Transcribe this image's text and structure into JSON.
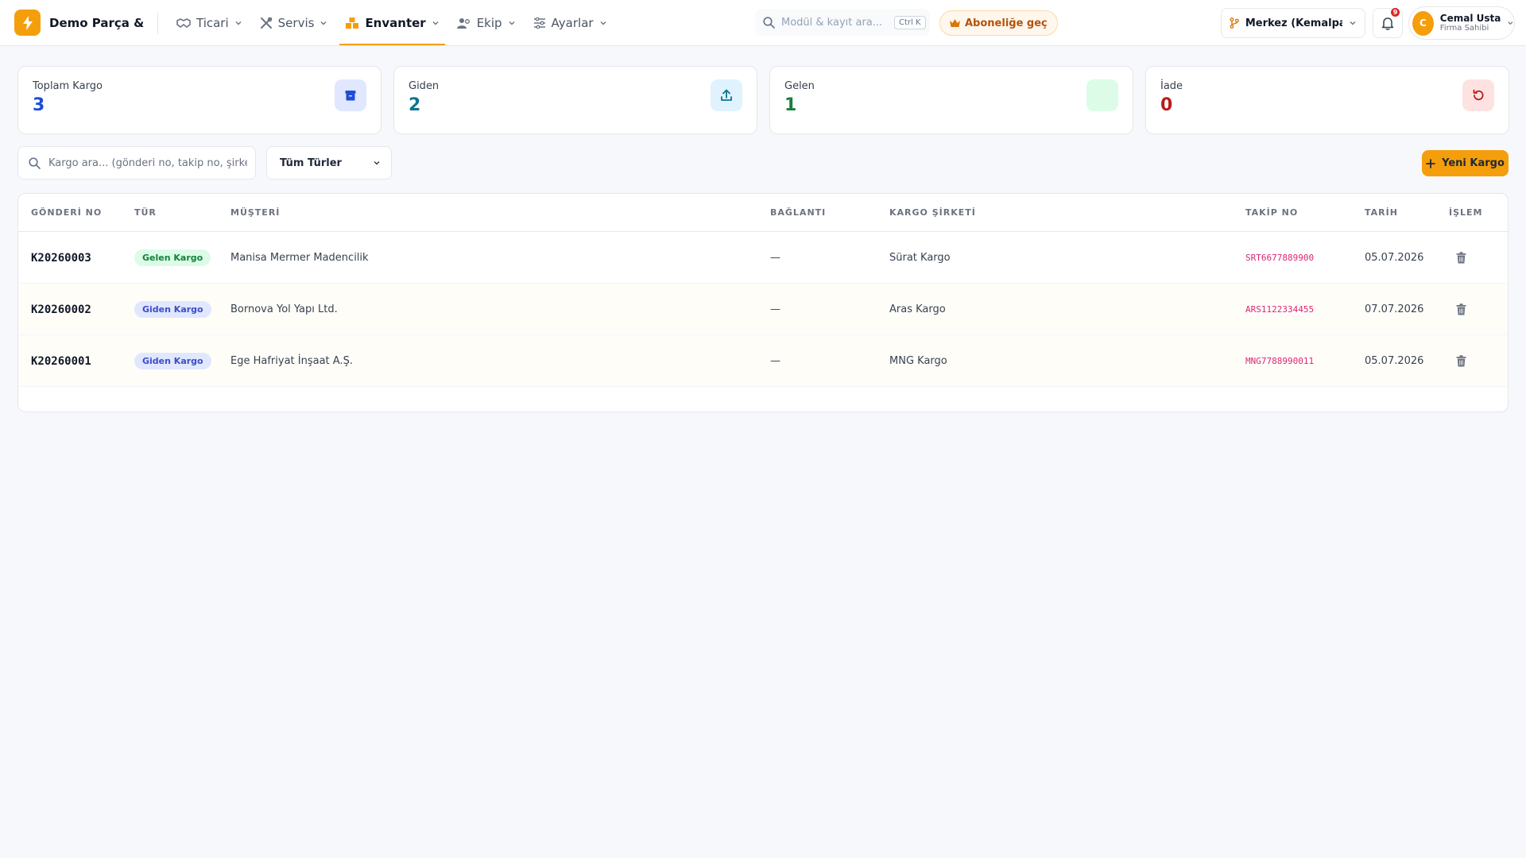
{
  "brand": {
    "name": "Demo Parça & ..."
  },
  "nav": [
    {
      "label": "Ticari"
    },
    {
      "label": "Servis"
    },
    {
      "label": "Envanter"
    },
    {
      "label": "Ekip"
    },
    {
      "label": "Ayarlar"
    }
  ],
  "search": {
    "placeholder": "Modül & kayıt ara...",
    "shortcut": "Ctrl K"
  },
  "upgrade": {
    "label": "Aboneliğe geç"
  },
  "branch": {
    "label": "Merkez (Kemalpa..."
  },
  "notifications": {
    "count": "9"
  },
  "user": {
    "initial": "C",
    "name": "Cemal Usta",
    "role": "Firma Sahibi"
  },
  "stats": [
    {
      "label": "Toplam Kargo",
      "value": "3",
      "color": "#1d4ed8",
      "icon_bg": "#e0e7ff",
      "icon": "box-icon"
    },
    {
      "label": "Giden",
      "value": "2",
      "color": "#0e7490",
      "icon_bg": "#e0f2fe",
      "icon": "upload-icon"
    },
    {
      "label": "Gelen",
      "value": "1",
      "color": "#15803d",
      "icon_bg": "#dcfce7",
      "icon": ""
    },
    {
      "label": "İade",
      "value": "0",
      "color": "#b91c1c",
      "icon_bg": "#fee2e2",
      "icon": "undo-icon"
    }
  ],
  "filters": {
    "search_placeholder": "Kargo ara... (gönderi no, takip no, şirket)",
    "type_value": "Tüm Türler",
    "new_label": "Yeni Kargo"
  },
  "table": {
    "headers": [
      "GÖNDERİ NO",
      "TÜR",
      "MÜŞTERİ",
      "BAĞLANTI",
      "KARGO ŞİRKETİ",
      "TAKİP NO",
      "TARİH",
      "İŞLEM"
    ],
    "rows": [
      {
        "code": "K20260003",
        "type": "Gelen Kargo",
        "type_kind": "in",
        "customer": "Manisa Mermer Madencilik",
        "link": "—",
        "carrier": "Sürat Kargo",
        "tracking": "SRT6677889900",
        "date": "05.07.2026"
      },
      {
        "code": "K20260002",
        "type": "Giden Kargo",
        "type_kind": "out",
        "customer": "Bornova Yol Yapı Ltd.",
        "link": "—",
        "carrier": "Aras Kargo",
        "tracking": "ARS1122334455",
        "date": "07.07.2026"
      },
      {
        "code": "K20260001",
        "type": "Giden Kargo",
        "type_kind": "out",
        "customer": "Ege Hafriyat İnşaat A.Ş.",
        "link": "—",
        "carrier": "MNG Kargo",
        "tracking": "MNG7788990011",
        "date": "05.07.2026"
      }
    ]
  }
}
